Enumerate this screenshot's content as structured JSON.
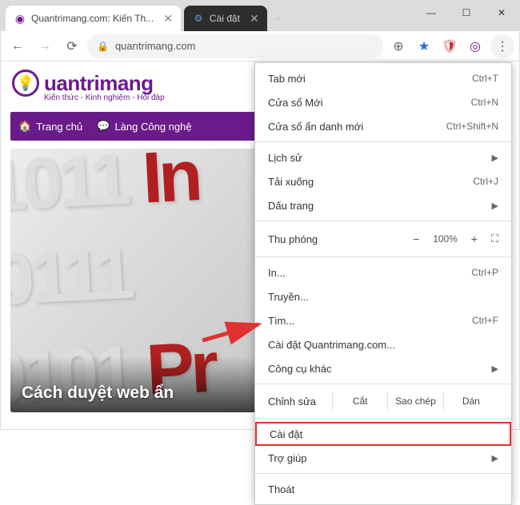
{
  "window": {
    "min": "—",
    "max": "☐",
    "close": "✕"
  },
  "tabs": [
    {
      "title": "Quantrimang.com: Kiến Th...",
      "active": true
    },
    {
      "title": "Cài đặt",
      "active": false
    }
  ],
  "toolbar": {
    "back": "←",
    "fwd": "→",
    "reload": "⟳"
  },
  "addrbar": {
    "lock": "🔒",
    "url": "quantrimang.com"
  },
  "ext": {
    "plus": "⊕",
    "star": "★",
    "shield": "🛡",
    "circle": "◎",
    "menu": "⋮"
  },
  "logo": {
    "text": "uantrimang",
    "tag": "Kiến thức - Kinh nghiệm - Hỏi đáp",
    "bulb": "💡"
  },
  "nav": [
    {
      "icon": "🏠",
      "label": "Trang chủ"
    },
    {
      "icon": "💬",
      "label": "Làng Công nghệ"
    }
  ],
  "hero": {
    "row1": "1011",
    "row2a": "0111",
    "row3a": "0101",
    "redIn": "In",
    "redPr": "Pr",
    "title": "Cách duyệt web ẩn"
  },
  "watermark": "uantrimang",
  "menu": {
    "newtab": {
      "label": "Tab mới",
      "sc": "Ctrl+T"
    },
    "newwin": {
      "label": "Cửa sổ Mới",
      "sc": "Ctrl+N"
    },
    "incog": {
      "label": "Cửa sổ ẩn danh mới",
      "sc": "Ctrl+Shift+N"
    },
    "history": {
      "label": "Lịch sử"
    },
    "downloads": {
      "label": "Tải xuống",
      "sc": "Ctrl+J"
    },
    "bookmarks": {
      "label": "Dấu trang"
    },
    "zoom": {
      "label": "Thu phóng",
      "minus": "−",
      "value": "100%",
      "plus": "+",
      "fs": "⛶"
    },
    "print": {
      "label": "In...",
      "sc": "Ctrl+P"
    },
    "cast": {
      "label": "Truyền..."
    },
    "find": {
      "label": "Tìm...",
      "sc": "Ctrl+F"
    },
    "install": {
      "label": "Cài đặt Quantrimang.com..."
    },
    "more": {
      "label": "Công cụ khác"
    },
    "edit": {
      "label": "Chỉnh sửa",
      "cut": "Cắt",
      "copy": "Sao chép",
      "paste": "Dán"
    },
    "settings": {
      "label": "Cài đặt"
    },
    "help": {
      "label": "Trợ giúp"
    },
    "exit": {
      "label": "Thoát"
    }
  },
  "arrow": "▶"
}
